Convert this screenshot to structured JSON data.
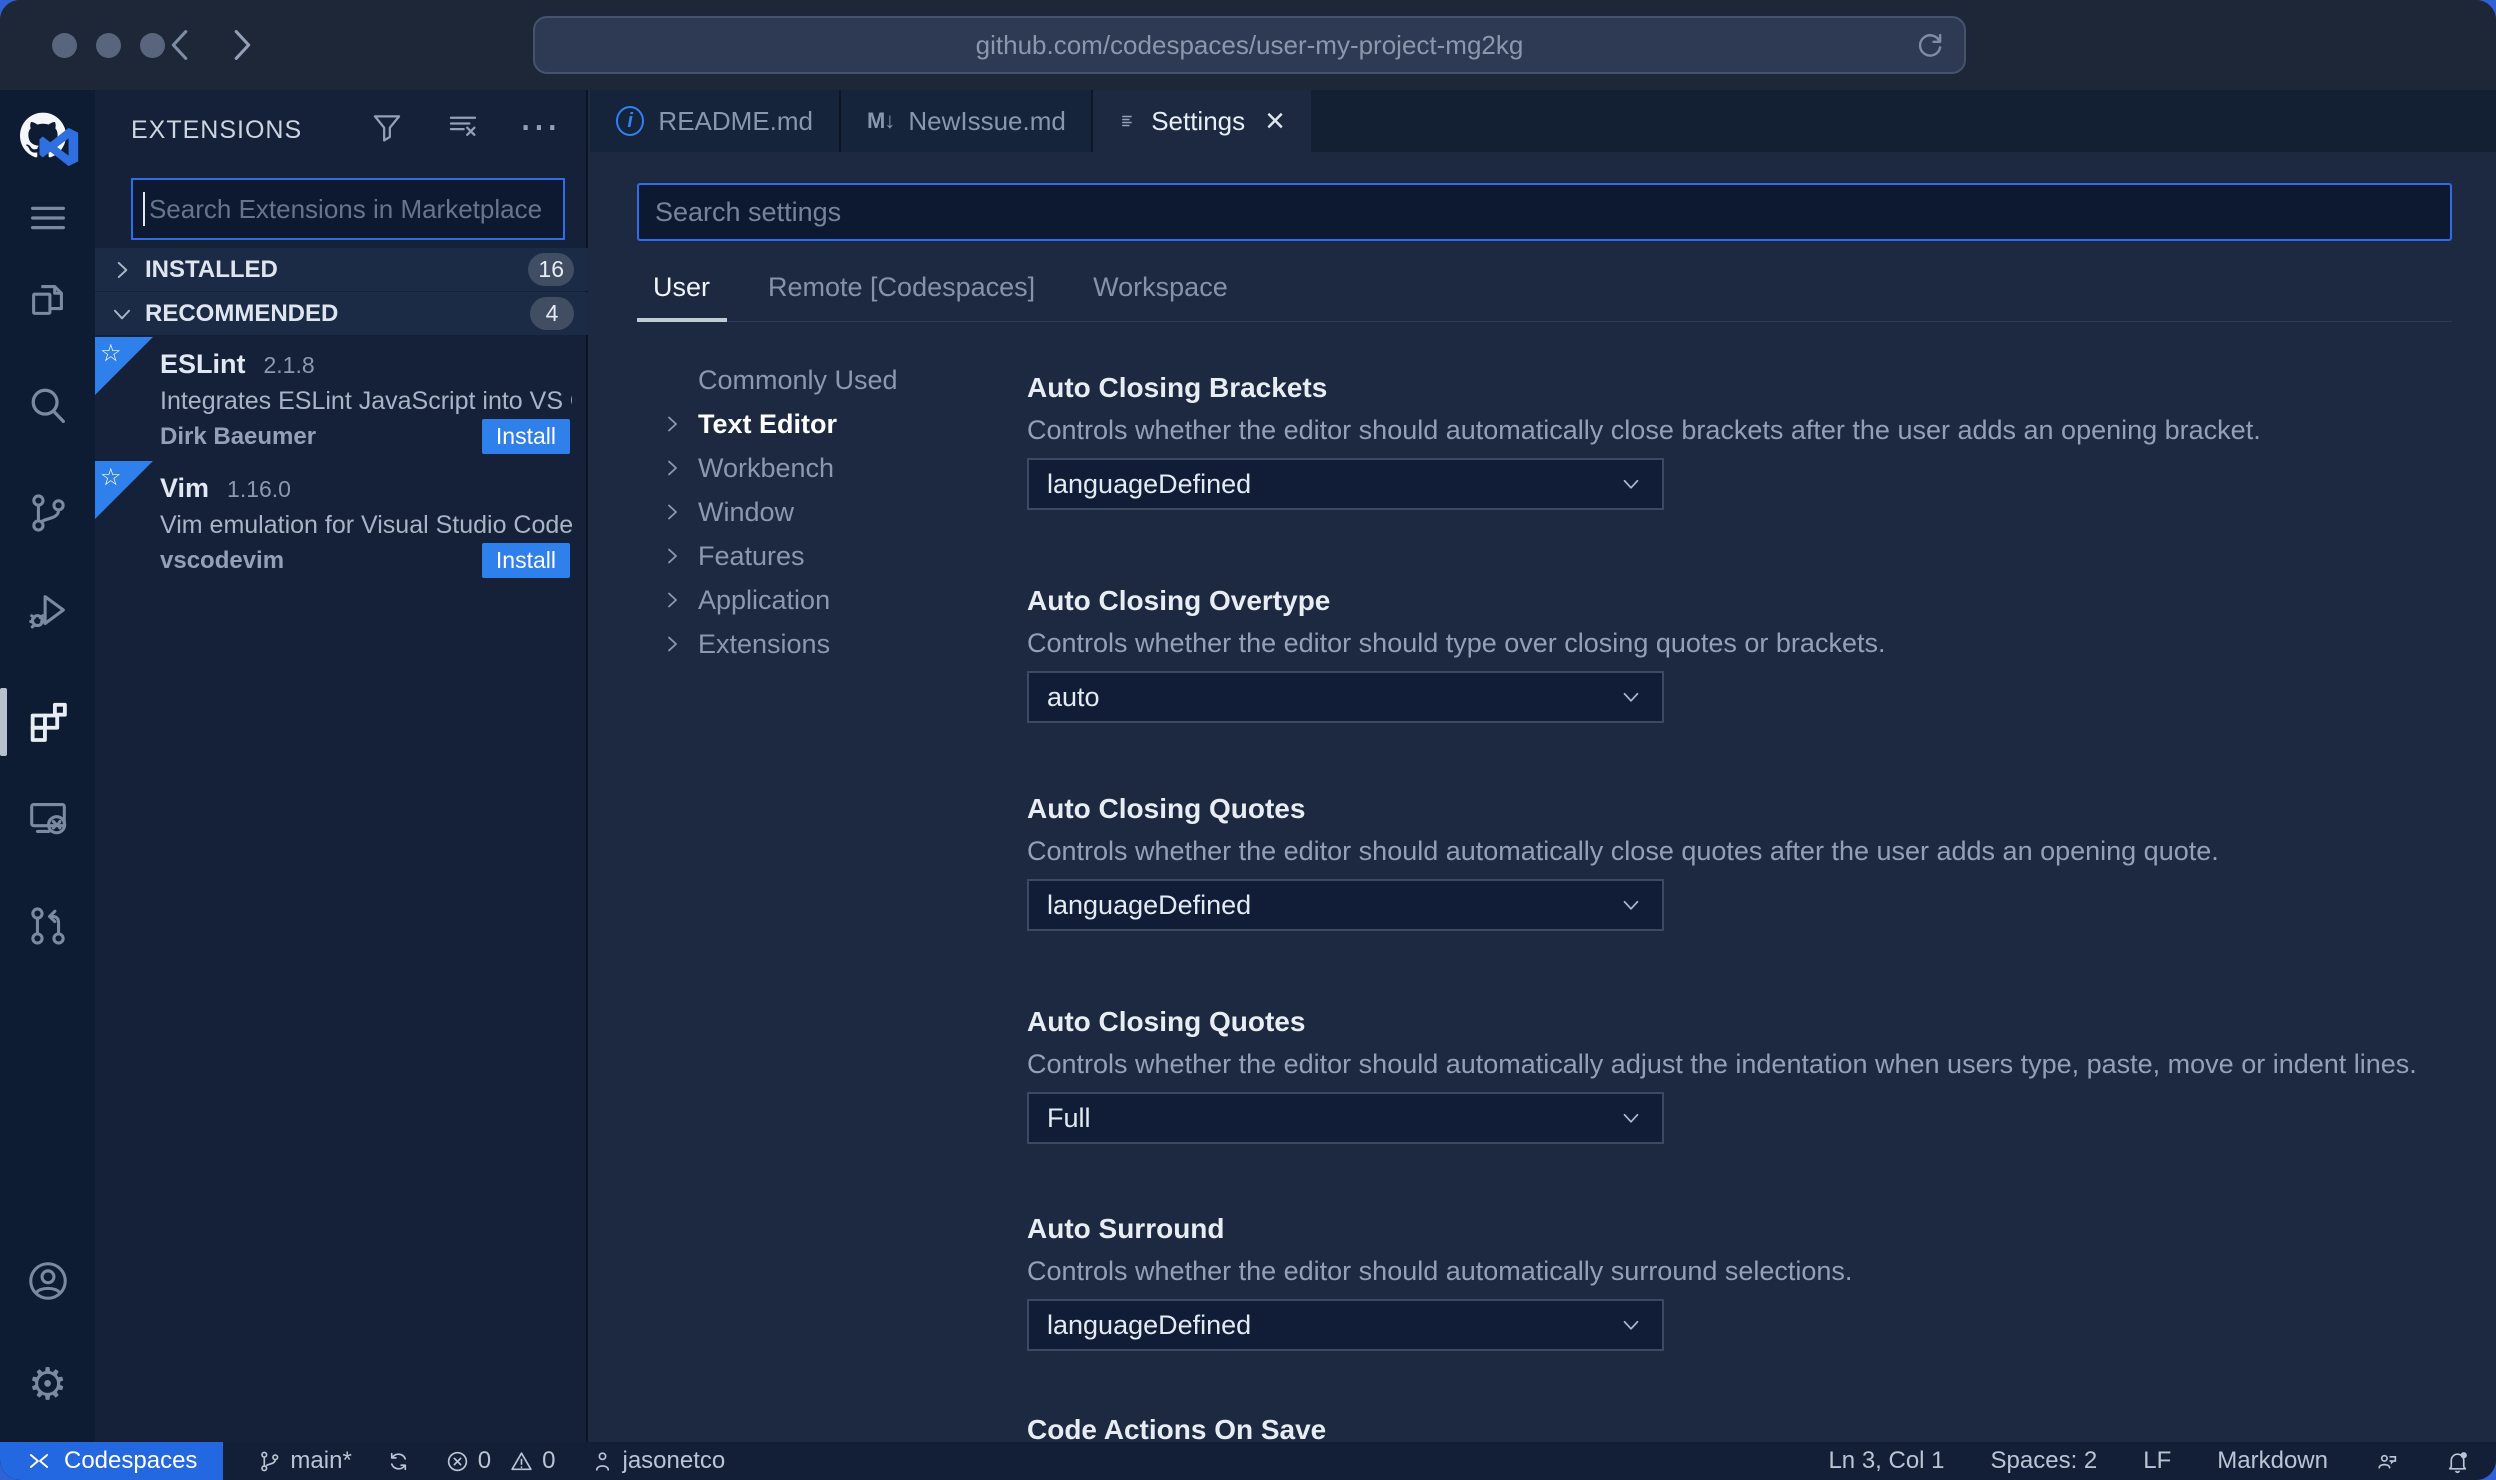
{
  "browser": {
    "url": "github.com/codespaces/user-my-project-mg2kg"
  },
  "icons": {
    "more": "⋯",
    "close": "×",
    "markdown": "M↓",
    "info": "i",
    "star": "☆",
    "gear": "⚙"
  },
  "sidebar": {
    "title": "EXTENSIONS",
    "search_placeholder": "Search Extensions in Marketplace",
    "sections": [
      {
        "label": "INSTALLED",
        "count": "16"
      },
      {
        "label": "RECOMMENDED",
        "count": "4"
      }
    ],
    "extensions": [
      {
        "name": "ESLint",
        "version": "2.1.8",
        "description": "Integrates ESLint JavaScript into VS C...",
        "publisher": "Dirk Baeumer",
        "action": "Install"
      },
      {
        "name": "Vim",
        "version": "1.16.0",
        "description": "Vim emulation for Visual Studio Code...",
        "publisher": "vscodevim",
        "action": "Install"
      }
    ]
  },
  "editor_tabs": [
    {
      "label": "README.md"
    },
    {
      "label": "NewIssue.md"
    },
    {
      "label": "Settings"
    }
  ],
  "settings": {
    "search_placeholder": "Search settings",
    "scopes": [
      "User",
      "Remote [Codespaces]",
      "Workspace"
    ],
    "toc": [
      "Commonly Used",
      "Text Editor",
      "Workbench",
      "Window",
      "Features",
      "Application",
      "Extensions"
    ],
    "active_toc": "Text Editor",
    "items": [
      {
        "title": "Auto Closing Brackets",
        "description": "Controls whether the editor should automatically close brackets after the user adds an opening bracket.",
        "value": "languageDefined"
      },
      {
        "title": "Auto Closing Overtype",
        "description": "Controls whether the editor should type over closing quotes or brackets.",
        "value": "auto"
      },
      {
        "title": "Auto Closing Quotes",
        "description": "Controls whether the editor should automatically close quotes after the user adds an opening quote.",
        "value": "languageDefined"
      },
      {
        "title": "Auto Closing Quotes",
        "description": "Controls whether the editor should automatically adjust the indentation when users type, paste, move or indent lines.",
        "value": "Full"
      },
      {
        "title": "Auto Surround",
        "description": "Controls whether the editor should automatically surround selections.",
        "value": "languageDefined"
      },
      {
        "title": "Code Actions On Save"
      }
    ]
  },
  "status_bar": {
    "codespaces": "Codespaces",
    "branch": "main*",
    "errors": "0",
    "warnings": "0",
    "user": "jasonetco",
    "line_col": "Ln 3, Col 1",
    "spaces": "Spaces: 2",
    "eol": "LF",
    "language": "Markdown"
  },
  "colors": {
    "accent_border": "#2d6ee8",
    "install_blue": "#2f80ea",
    "statusbar_blue": "#2368e0",
    "editor_bg": "#1c2940",
    "sidebar_bg": "#142139",
    "activitybar_bg": "#0e1c33",
    "chrome_bg": "#1d2737"
  }
}
